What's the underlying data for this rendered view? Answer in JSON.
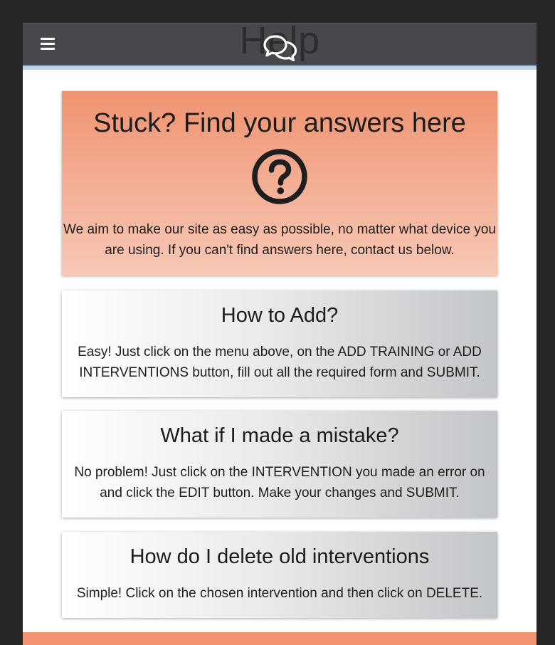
{
  "header": {
    "title": "Help",
    "menu_icon": "hamburger-menu-icon",
    "center_icon": "chat-bubbles-icon",
    "bar_color": "#46484b",
    "underline_color": "#b9d3ec"
  },
  "hero": {
    "heading": "Stuck? Find your answers here",
    "icon": "question-circle-icon",
    "text": "We aim to make our site as easy as possible, no matter what device you are using. If you can't find answers here, contact us below.",
    "color": "#ef9371"
  },
  "faqs": [
    {
      "question": "How to Add?",
      "answer": "Easy! Just click on the menu above, on the ADD TRAINING or ADD INTERVENTIONS button, fill out all the required form and SUBMIT."
    },
    {
      "question": "What if I made a mistake?",
      "answer": "No problem! Just click on the INTERVENTION you made an error on and click the EDIT button. Make your changes and SUBMIT."
    },
    {
      "question": "How do I delete old interventions",
      "answer": "Simple! Click on the chosen intervention and then click on DELETE."
    }
  ],
  "footer": {
    "color": "#ef9371"
  }
}
